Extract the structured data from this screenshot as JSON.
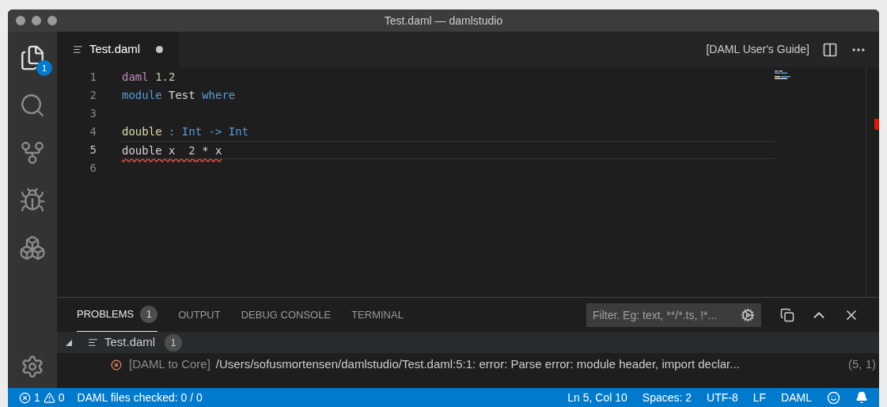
{
  "window": {
    "title": "Test.daml — damlstudio"
  },
  "activity_bar": {
    "items": [
      {
        "kind": "files",
        "selected": true,
        "badge": "1"
      },
      {
        "kind": "search",
        "selected": false
      },
      {
        "kind": "source-control",
        "selected": false
      },
      {
        "kind": "debug",
        "selected": false
      },
      {
        "kind": "extensions",
        "selected": false
      }
    ]
  },
  "editor_tabs": [
    {
      "label": "Test.daml",
      "selected": true,
      "modified": true
    }
  ],
  "editor_actions": {
    "link": "[DAML User's Guide]"
  },
  "code": {
    "lines": [
      {
        "number": "1",
        "current": false,
        "error": false,
        "tokens": [
          {
            "text": "daml",
            "kind": "keyword"
          },
          {
            "text": " 1.2",
            "kind": "number"
          }
        ]
      },
      {
        "number": "2",
        "current": false,
        "error": false,
        "tokens": [
          {
            "text": "module",
            "kind": "type"
          },
          {
            "text": " Test ",
            "kind": "plain"
          },
          {
            "text": "where",
            "kind": "type"
          }
        ]
      },
      {
        "number": "3",
        "current": false
      },
      {
        "number": "4",
        "current": false,
        "error": false,
        "tokens": [
          {
            "text": "double",
            "kind": "function"
          },
          {
            "text": " : Int -> Int",
            "kind": "type"
          }
        ]
      },
      {
        "number": "5",
        "current": true,
        "error": true,
        "tokens": [
          {
            "text": "double x  ",
            "kind": "plain"
          },
          {
            "text": "2",
            "kind": "number"
          },
          {
            "text": " * x",
            "kind": "plain"
          }
        ]
      },
      {
        "number": "6",
        "current": false
      }
    ]
  },
  "panel": {
    "tabs": [
      {
        "label": "PROBLEMS",
        "selected": true,
        "badge": "1"
      },
      {
        "label": "OUTPUT",
        "selected": false
      },
      {
        "label": "DEBUG CONSOLE",
        "selected": false
      },
      {
        "label": "TERMINAL",
        "selected": false
      }
    ],
    "filter": {
      "placeholder": "Filter. Eg: text, **/*.ts, !*..."
    },
    "problems": [
      {
        "file": "Test.daml",
        "count": "1",
        "expanded": true,
        "items": [
          {
            "kind": "error",
            "source": "[DAML to Core]",
            "message": "/Users/sofusmortensen/damlstudio/Test.daml:5:1: error: Parse error: module header, import declar...",
            "position": "(5, 1)"
          }
        ]
      }
    ]
  },
  "status_bar": {
    "errors": "1",
    "warnings": "0",
    "left": [
      "DAML files checked: 0 / 0"
    ],
    "right": [
      "Ln 5, Col 10",
      "Spaces: 2",
      "UTF-8",
      "LF",
      "DAML"
    ]
  }
}
